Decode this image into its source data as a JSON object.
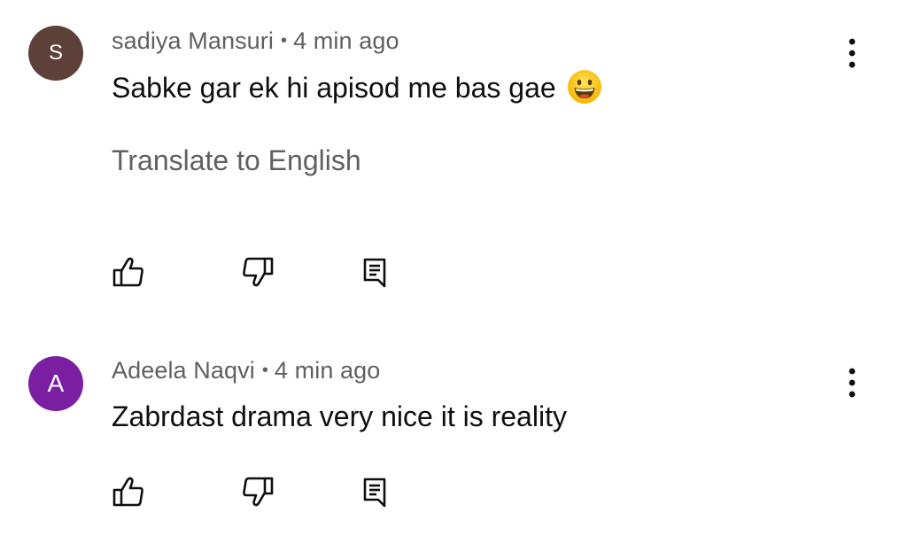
{
  "comments": [
    {
      "avatar_letter": "S",
      "avatar_color": "#5d4037",
      "author": "sadiya Mansuri",
      "separator": "•",
      "time": "4 min ago",
      "text": "Sabke gar ek hi apisod me bas gae",
      "emoji": "grinning-face-emoji",
      "translate_label": "Translate to English",
      "icons": [
        "thumbs-up-icon",
        "thumbs-down-icon",
        "reply-icon",
        "more-vert-icon"
      ]
    },
    {
      "avatar_letter": "A",
      "avatar_color": "#7b1fa2",
      "author": "Adeela Naqvi",
      "separator": "•",
      "time": "4 min ago",
      "text": "Zabrdast drama very nice it is reality",
      "icons": [
        "thumbs-up-icon",
        "thumbs-down-icon",
        "reply-icon",
        "more-vert-icon"
      ]
    }
  ],
  "colors": {
    "meta_text": "#606060",
    "body_text": "#0f0f0f",
    "icon": "#0f0f0f",
    "background": "#ffffff"
  }
}
